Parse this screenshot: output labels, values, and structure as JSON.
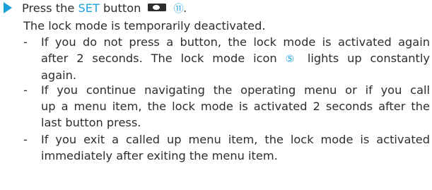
{
  "colors": {
    "accent": "#1aa0dc",
    "text": "#2d2d2d"
  },
  "step": {
    "icon": "triangle-arrow-icon",
    "prefix": "Press the ",
    "set_label": "SET",
    "suffix": " button",
    "button_icon": "set-button-icon",
    "ref_number": "⑪",
    "period": "."
  },
  "result": "The lock mode is temporarily deactivated.",
  "bullets": [
    {
      "dash": "-",
      "lines": [
        "If you do not press a button, the lock mode is activated again",
        "after 2 seconds. The lock mode icon",
        "lights up constantly",
        "again."
      ],
      "ref_number": "⑤"
    },
    {
      "dash": "-",
      "lines": [
        "If you continue navigating the operating menu or if you call",
        "up a menu item, the lock mode is activated 2 seconds after the",
        "last button press."
      ]
    },
    {
      "dash": "-",
      "lines": [
        "If you exit a called up menu item, the lock mode is activated",
        "immediately after exiting the menu item."
      ]
    }
  ]
}
